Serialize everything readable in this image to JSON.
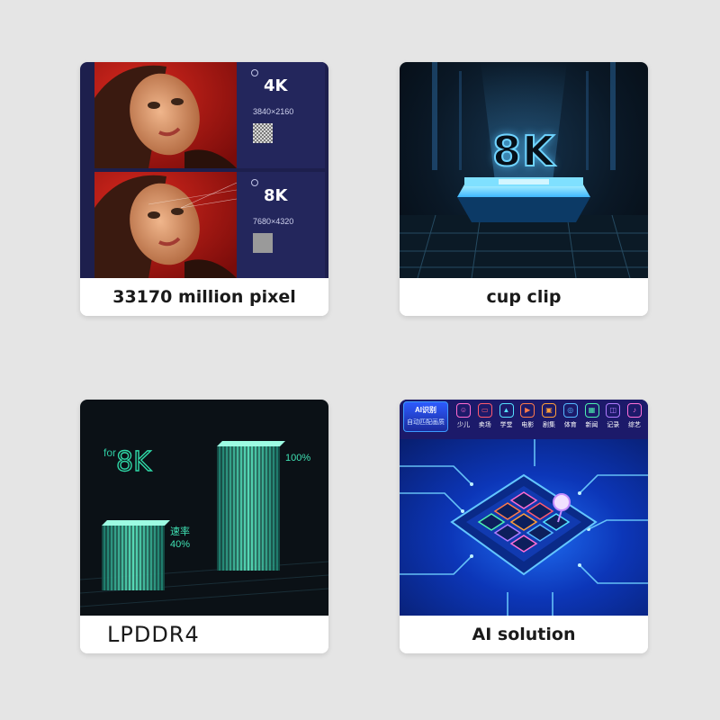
{
  "cards": [
    {
      "caption": "33170 million pixel",
      "panels": [
        {
          "resolution": "4K",
          "dimensions": "3840×2160"
        },
        {
          "resolution": "8K",
          "dimensions": "7680×4320"
        }
      ]
    },
    {
      "caption": "cup clip",
      "overlay_text": "8K"
    },
    {
      "caption": "LPDDR4",
      "overlay_for": "for",
      "overlay_8k": "8K",
      "bar_small_label": "速率",
      "bar_small_value": "40%",
      "bar_large_value": "100%"
    },
    {
      "caption": "AI solution",
      "badge_title": "AI识别",
      "badge_subtitle": "自动匹配画质",
      "categories": [
        {
          "label": "少儿",
          "color": "#ff6bd0",
          "glyph": "☺"
        },
        {
          "label": "卖场",
          "color": "#ff5a6e",
          "glyph": "▭"
        },
        {
          "label": "学堂",
          "color": "#54e0ff",
          "glyph": "▲"
        },
        {
          "label": "电影",
          "color": "#ff7a4a",
          "glyph": "▶"
        },
        {
          "label": "剧集",
          "color": "#ff9e3a",
          "glyph": "▣"
        },
        {
          "label": "体育",
          "color": "#56b9ff",
          "glyph": "◎"
        },
        {
          "label": "新闻",
          "color": "#4cf0b0",
          "glyph": "▦"
        },
        {
          "label": "记录",
          "color": "#b07bff",
          "glyph": "◫"
        },
        {
          "label": "综艺",
          "color": "#ff6fd8",
          "glyph": "♪"
        }
      ]
    }
  ],
  "colors": {
    "page_bg": "#e5e5e5",
    "card_bg": "#ffffff",
    "caption_text": "#1a1a1a",
    "navy_panel": "#1d1f4d",
    "neon_cyan": "#6fd3ff",
    "neon_green": "#2fd7a6",
    "ai_blue": "#1f6df2"
  }
}
